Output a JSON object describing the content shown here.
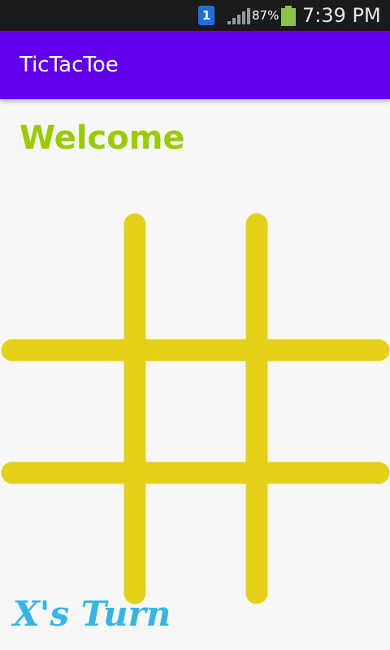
{
  "status_bar": {
    "notification_badge": "1",
    "battery_percent": "87%",
    "time": "7:39 PM",
    "icons": [
      "notification-icon",
      "signal-icon",
      "battery-icon"
    ]
  },
  "app_bar": {
    "title": "TicTacToe",
    "color": "#6200ee"
  },
  "main": {
    "welcome_text": "Welcome",
    "welcome_color": "#99cc00",
    "turn_text": "X's Turn",
    "turn_color": "#33b5e5"
  },
  "board": {
    "line_color": "#e5d11a",
    "rows": 3,
    "cols": 3,
    "cells": [
      "",
      "",
      "",
      "",
      "",
      "",
      "",
      "",
      ""
    ]
  }
}
